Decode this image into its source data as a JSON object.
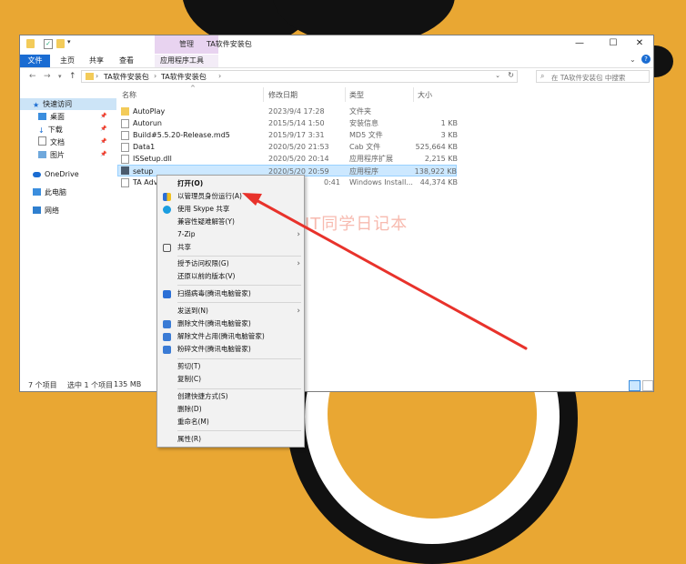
{
  "window": {
    "title": "TA软件安装包",
    "manage_tab": "管理",
    "controls": {
      "minimize": "—",
      "maximize": "☐",
      "close": "✕"
    }
  },
  "ribbon": {
    "tabs": [
      "文件",
      "主页",
      "共享",
      "查看",
      "应用程序工具"
    ],
    "help": "?"
  },
  "address": {
    "crumbs": [
      "TA软件安装包",
      "TA软件安装包"
    ],
    "search_placeholder": "在 TA软件安装包 中搜索"
  },
  "nav": {
    "items": [
      "快速访问",
      "桌面",
      "下载",
      "文档",
      "图片",
      "OneDrive",
      "此电脑",
      "网络"
    ]
  },
  "columns": {
    "name": "名称",
    "date": "修改日期",
    "type": "类型",
    "size": "大小"
  },
  "files": [
    {
      "name": "AutoPlay",
      "date": "2023/9/4 17:28",
      "type": "文件夹",
      "size": "",
      "icon": "folder-icon"
    },
    {
      "name": "Autorun",
      "date": "2015/5/14 1:50",
      "type": "安装信息",
      "size": "1 KB",
      "icon": "settings-file-icon"
    },
    {
      "name": "Build#5.5.20-Release.md5",
      "date": "2015/9/17 3:31",
      "type": "MD5 文件",
      "size": "3 KB",
      "icon": "file-icon"
    },
    {
      "name": "Data1",
      "date": "2020/5/20 21:53",
      "type": "Cab 文件",
      "size": "525,664 KB",
      "icon": "archive-icon"
    },
    {
      "name": "ISSetup.dll",
      "date": "2020/5/20 20:14",
      "type": "应用程序扩展",
      "size": "2,215 KB",
      "icon": "dll-icon"
    },
    {
      "name": "setup",
      "date": "2020/5/20 20:59",
      "type": "应用程序",
      "size": "138,922 KB",
      "icon": "app-icon"
    },
    {
      "name": "TA Adva",
      "date": "0:41",
      "type": "Windows Install...",
      "size": "44,374 KB",
      "icon": "installer-icon"
    }
  ],
  "status": {
    "count": "7 个项目",
    "selected": "选中 1 个项目",
    "size": "135 MB"
  },
  "context_menu": [
    {
      "label": "打开(O)",
      "bold": true
    },
    {
      "label": "以管理员身份运行(A)",
      "icon": "shield-icon"
    },
    {
      "label": "使用 Skype 共享",
      "icon": "skype-icon"
    },
    {
      "label": "兼容性疑难解答(Y)"
    },
    {
      "label": "7-Zip",
      "submenu": true
    },
    {
      "label": "共享",
      "icon": "share-icon"
    },
    {
      "label": "授予访问权限(G)",
      "submenu": true
    },
    {
      "label": "还原以前的版本(V)"
    },
    {
      "label": "扫描病毒(腾讯电脑管家)",
      "icon": "tencent-shield-icon"
    },
    {
      "label": "发送到(N)",
      "submenu": true
    },
    {
      "label": "删除文件(腾讯电脑管家)",
      "icon": "delete-icon"
    },
    {
      "label": "解除文件占用(腾讯电脑管家)",
      "icon": "unlock-icon"
    },
    {
      "label": "粉碎文件(腾讯电脑管家)",
      "icon": "shred-icon"
    },
    {
      "label": "剪切(T)"
    },
    {
      "label": "复制(C)"
    },
    {
      "label": "创建快捷方式(S)"
    },
    {
      "label": "删除(D)"
    },
    {
      "label": "重命名(M)"
    },
    {
      "label": "属性(R)"
    }
  ],
  "watermark": "IT同学日记本",
  "colors": {
    "background": "#e9a733",
    "accent": "#1a6cd2",
    "selection": "#cce8ff",
    "arrow": "#e8322b"
  }
}
